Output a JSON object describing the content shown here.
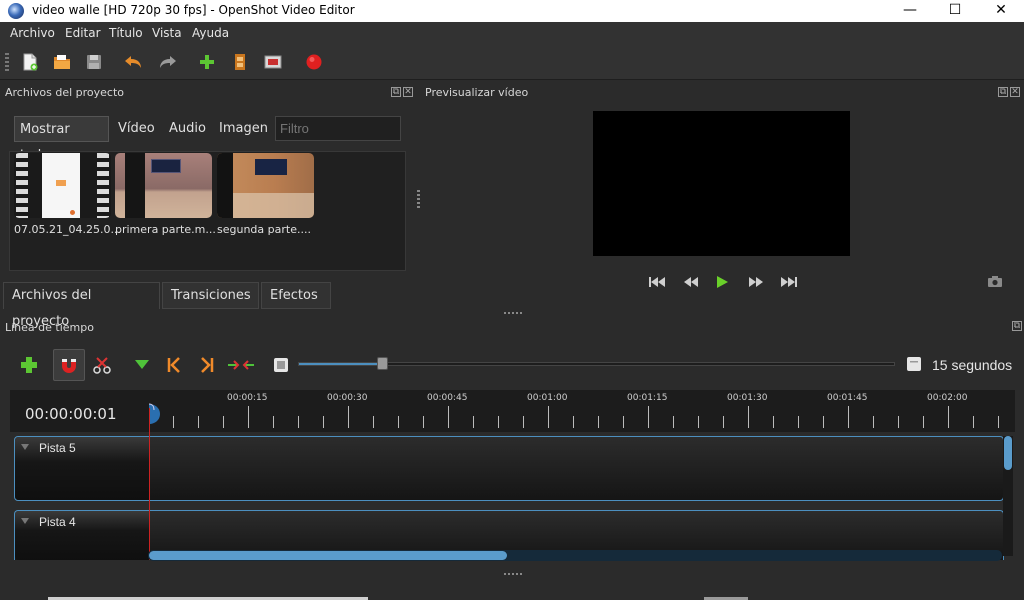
{
  "window": {
    "title": "video walle [HD 720p 30 fps] - OpenShot Video Editor",
    "minimize": "—",
    "maximize": "☐",
    "close": "✕"
  },
  "menu": [
    "Archivo",
    "Editar",
    "Título",
    "Vista",
    "Ayuda"
  ],
  "toolbar_icons": [
    "new-file-icon",
    "open-folder-icon",
    "save-icon",
    "undo-icon",
    "redo-icon",
    "import-files-icon",
    "choose-profile-icon",
    "export-film-icon",
    "record-icon"
  ],
  "project_files": {
    "title": "Archivos del proyecto",
    "filters": [
      "Mostrar todo",
      "Vídeo",
      "Audio",
      "Imagen"
    ],
    "filter_placeholder": "Filtro",
    "files": [
      {
        "name": "07.05.21_04.25.0..."
      },
      {
        "name": "primera parte.m..."
      },
      {
        "name": "segunda parte...."
      }
    ],
    "bottom_tabs": [
      "Archivos del proyecto",
      "Transiciones",
      "Efectos"
    ]
  },
  "preview": {
    "title": "Previsualizar vídeo"
  },
  "timeline": {
    "title": "Línea de tiempo",
    "zoom_label": "15 segundos",
    "zoom_level": 0.14,
    "timecode": "00:00:00:01",
    "ticks": [
      "00:00:15",
      "00:00:30",
      "00:00:45",
      "00:01:00",
      "00:01:15",
      "00:01:30",
      "00:01:45",
      "00:02:00"
    ],
    "tracks": [
      "Pista 5",
      "Pista 4"
    ],
    "scroll_fraction": 0.42
  },
  "colors": {
    "accent": "#4c8fbf",
    "playhead": "#cc2222",
    "record": "#e02020",
    "add": "#5cc633"
  }
}
